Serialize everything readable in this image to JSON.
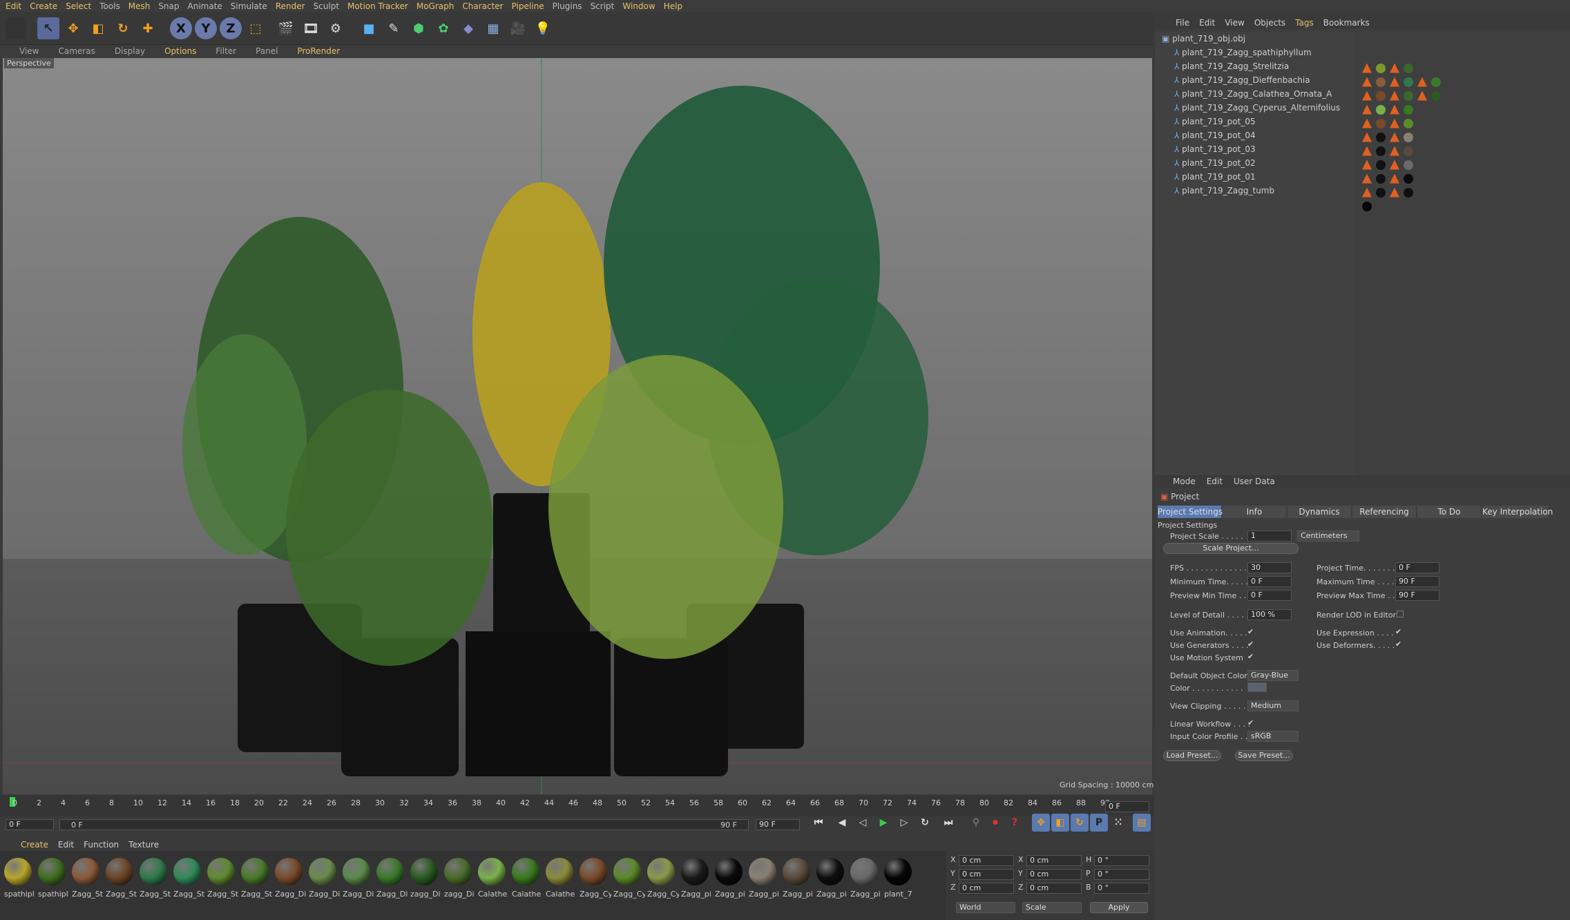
{
  "menubar": [
    "Edit",
    "Create",
    "Select",
    "Tools",
    "Mesh",
    "Snap",
    "Animate",
    "Simulate",
    "Render",
    "Sculpt",
    "Motion Tracker",
    "MoGraph",
    "Character",
    "Pipeline",
    "Plugins",
    "Script",
    "Window",
    "Help"
  ],
  "viewport_menu": [
    "View",
    "Cameras",
    "Display",
    "Options",
    "Filter",
    "Panel",
    "ProRender"
  ],
  "viewport": {
    "label": "Perspective",
    "grid_spacing": "Grid Spacing : 10000 cm"
  },
  "object_manager": {
    "menu": [
      "File",
      "Edit",
      "View",
      "Objects",
      "Tags",
      "Bookmarks"
    ],
    "root": "plant_719_obj.obj",
    "objects": [
      "plant_719_Zagg_spathiphyllum",
      "plant_719_Zagg_Strelitzia",
      "plant_719_Zagg_Dieffenbachia",
      "plant_719_Zagg_Calathea_Ornata_A",
      "plant_719_Zagg_Cyperus_Alternifolius",
      "plant_719_pot_05",
      "plant_719_pot_04",
      "plant_719_pot_03",
      "plant_719_pot_02",
      "plant_719_pot_01",
      "plant_719_Zagg_tumb"
    ]
  },
  "attributes": {
    "menu": [
      "Mode",
      "Edit",
      "User Data"
    ],
    "header": "Project",
    "tabs": [
      "Project Settings",
      "Info",
      "Dynamics",
      "Referencing",
      "To Do",
      "Key Interpolation"
    ],
    "section": "Project Settings",
    "project_scale_label": "Project Scale . . . . .",
    "project_scale": "1",
    "units": "Centimeters",
    "scale_project_btn": "Scale Project...",
    "fps_label": "FPS . . . . . . . . . . . . .",
    "fps": "30",
    "min_time_label": "Minimum Time. . . . .",
    "min_time": "0 F",
    "preview_min_label": "Preview Min Time . .",
    "preview_min": "0 F",
    "project_time_label": "Project Time. . . . . . . .",
    "project_time": "0 F",
    "max_time_label": "Maximum Time . . . . .",
    "max_time": "90 F",
    "preview_max_label": "Preview Max Time . .",
    "preview_max": "90 F",
    "lod_label": "Level of Detail . . . . .",
    "lod": "100 %",
    "render_lod_label": "Render LOD in Editor",
    "use_animation": "Use Animation. . . . .",
    "use_generators": "Use Generators . . . .",
    "use_motion": "Use Motion System",
    "use_expression": "Use Expression . . . .",
    "use_deformers": "Use Deformers. . . . .",
    "default_color_label": "Default Object Color",
    "default_color": "Gray-Blue",
    "color_label": "Color . . . . . . . . . . .",
    "view_clipping_label": "View Clipping . . . . .",
    "view_clipping": "Medium",
    "linear_workflow": "Linear Workflow . . . .",
    "input_color_label": "Input Color Profile . .",
    "input_color": "sRGB",
    "load_preset": "Load Preset...",
    "save_preset": "Save Preset..."
  },
  "timeline": {
    "ticks": [
      "0",
      "2",
      "4",
      "6",
      "8",
      "10",
      "12",
      "14",
      "16",
      "18",
      "20",
      "22",
      "24",
      "26",
      "28",
      "30",
      "32",
      "34",
      "36",
      "38",
      "40",
      "42",
      "44",
      "46",
      "48",
      "50",
      "52",
      "54",
      "56",
      "58",
      "60",
      "62",
      "64",
      "66",
      "68",
      "70",
      "72",
      "74",
      "76",
      "78",
      "80",
      "82",
      "84",
      "86",
      "88",
      "90"
    ],
    "current": "0 F",
    "start": "0 F",
    "range_start": "0 F",
    "range_end": "90 F",
    "end": "90 F"
  },
  "material_manager": {
    "menu": [
      "Create",
      "Edit",
      "Function",
      "Texture"
    ],
    "materials": [
      {
        "name": "spathipl",
        "color": "#b9a62a"
      },
      {
        "name": "spathipl",
        "color": "#3f6e1f"
      },
      {
        "name": "Zagg_St",
        "color": "#8a5a3a"
      },
      {
        "name": "Zagg_St",
        "color": "#6b4425"
      },
      {
        "name": "Zagg_St",
        "color": "#2f7a4a"
      },
      {
        "name": "Zagg_St",
        "color": "#2f8a5a"
      },
      {
        "name": "Zagg_St",
        "color": "#5e8a2e"
      },
      {
        "name": "Zagg_St",
        "color": "#4a7a2a"
      },
      {
        "name": "Zagg_Di",
        "color": "#7a4a2a"
      },
      {
        "name": "Zagg_Di",
        "color": "#6a8a4a"
      },
      {
        "name": "Zagg_Di",
        "color": "#5a8a4a"
      },
      {
        "name": "Zagg_Di",
        "color": "#3a7a2a"
      },
      {
        "name": "zagg_Di",
        "color": "#2a5a1f"
      },
      {
        "name": "zagg_Di",
        "color": "#4a6a2a"
      },
      {
        "name": "Calathe",
        "color": "#7ab04a"
      },
      {
        "name": "Calathe",
        "color": "#3a7a1f"
      },
      {
        "name": "Calathe",
        "color": "#8a8a3a"
      },
      {
        "name": "Zagg_Cy",
        "color": "#7a4a2a"
      },
      {
        "name": "Zagg_Cy",
        "color": "#5a8a2a"
      },
      {
        "name": "Zagg_Cy",
        "color": "#8a9a4a"
      },
      {
        "name": "Zagg_pi",
        "color": "#1a1a1a"
      },
      {
        "name": "Zagg_pi",
        "color": "#0a0a0a"
      },
      {
        "name": "Zagg_pi",
        "color": "#8a8070"
      },
      {
        "name": "Zagg_pi",
        "color": "#5a4a3a"
      },
      {
        "name": "Zagg_pi",
        "color": "#0f0f0f"
      },
      {
        "name": "Zagg_pi",
        "color": "#6a6a6a"
      },
      {
        "name": "plant_7",
        "color": "#050505"
      }
    ]
  },
  "coordinates": {
    "rows": [
      {
        "a": "X",
        "av": "0 cm",
        "b": "X",
        "bv": "0 cm",
        "c": "H",
        "cv": "0 °"
      },
      {
        "a": "Y",
        "av": "0 cm",
        "b": "Y",
        "bv": "0 cm",
        "c": "P",
        "cv": "0 °"
      },
      {
        "a": "Z",
        "av": "0 cm",
        "b": "Z",
        "bv": "0 cm",
        "c": "B",
        "cv": "0 °"
      }
    ],
    "world": "World",
    "scale": "Scale",
    "apply": "Apply"
  }
}
